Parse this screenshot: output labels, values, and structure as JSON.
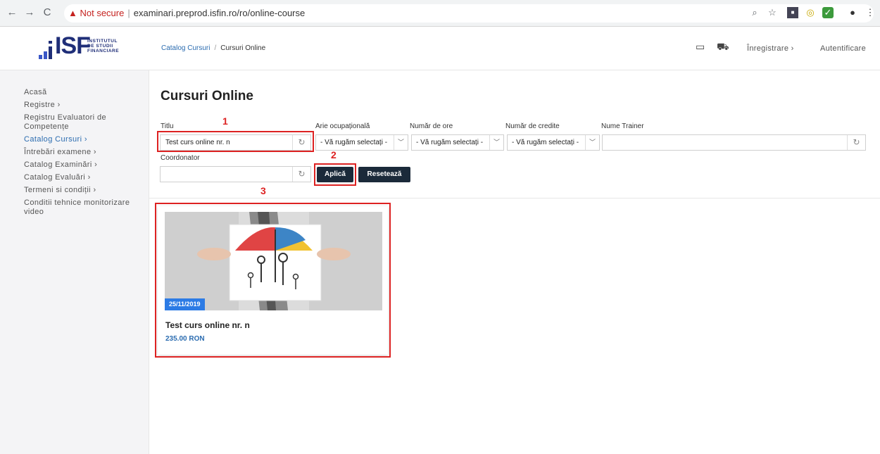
{
  "browser": {
    "nav_back": "←",
    "nav_forward": "→",
    "nav_reload": "C",
    "security_label": "▲ Not secure",
    "url": "examinari.preprod.isfin.ro/ro/online-course"
  },
  "logo": {
    "letters": "ISF",
    "line1": "INSTITUTUL",
    "line2": "DE STUDII",
    "line3": "FINANCIARE"
  },
  "sidebar": {
    "items": [
      {
        "label": "Acasă",
        "active": false
      },
      {
        "label": "Registre  ›",
        "active": false
      },
      {
        "label": "Registru Evaluatori de Competențe",
        "active": false
      },
      {
        "label": "Catalog Cursuri  ›",
        "active": true
      },
      {
        "label": "Întrebări examene  ›",
        "active": false
      },
      {
        "label": "Catalog Examinări  ›",
        "active": false
      },
      {
        "label": "Catalog Evaluări  ›",
        "active": false
      },
      {
        "label": "Termeni si condiții  ›",
        "active": false
      },
      {
        "label": "Conditii tehnice monitorizare video",
        "active": false
      }
    ]
  },
  "header": {
    "breadcrumb_1": "Catalog Cursuri",
    "breadcrumb_sep": "/",
    "breadcrumb_2": "Cursuri Online",
    "register": "Înregistrare  ›",
    "login": "Autentificare"
  },
  "main": {
    "title": "Cursuri Online",
    "filters": {
      "titlu_label": "Titlu",
      "titlu_value": "Test curs online nr. n",
      "arie_label": "Arie ocupațională",
      "arie_value": "- Vă rugăm selectați -",
      "ore_label": "Număr de ore",
      "ore_value": "- Vă rugăm selectați -",
      "credite_label": "Număr de credite",
      "credite_value": "- Vă rugăm selectați -",
      "trainer_label": "Nume Trainer",
      "trainer_value": "",
      "coord_label": "Coordonator",
      "coord_value": ""
    },
    "apply_button": "Aplică",
    "reset_button": "Resetează",
    "annotations": [
      "1",
      "2",
      "3"
    ],
    "course": {
      "date": "25/11/2019",
      "title": "Test curs online nr. n",
      "price": "235.00 RON"
    }
  },
  "colors": {
    "accent": "#2b6cb0",
    "button": "#1b2a3a",
    "annotation": "#d22222",
    "badge": "#2c7be5"
  }
}
